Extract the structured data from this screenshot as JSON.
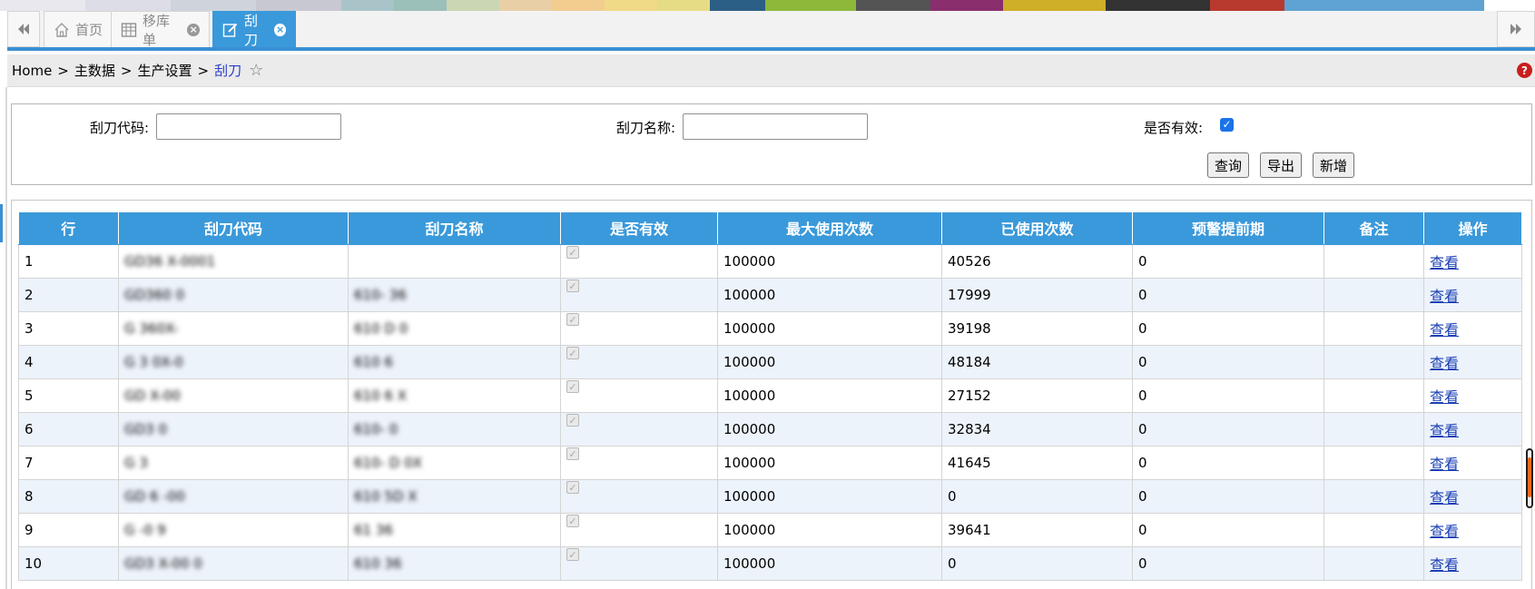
{
  "colors": {
    "accent": "#3a99da",
    "header_bg": "#3a99da",
    "row_alt": "#edf3fb",
    "link": "#1a3fb4",
    "help": "#c81e1e",
    "strip": [
      "#e8e8ee",
      "#dcdde6",
      "#cfd3dc",
      "#c7c8d2",
      "#a8c4c9",
      "#9bbfb9",
      "#cbd6b4",
      "#e8cfa6",
      "#f3cc90",
      "#f0d987",
      "#e6dc86",
      "#2c5f86",
      "#8db83a",
      "#545454",
      "#8a2e6e",
      "#cfae28",
      "#333333",
      "#b83a2e",
      "#5ea3d4"
    ]
  },
  "tabs": {
    "back_icon": "double-left-icon",
    "forward_icon": "double-right-icon",
    "items": [
      {
        "label": "首页",
        "icon": "home-icon",
        "active": false
      },
      {
        "label": "移库单",
        "icon": "grid-icon",
        "active": false
      },
      {
        "label": "刮刀",
        "icon": "edit-icon",
        "active": true
      }
    ]
  },
  "breadcrumb": {
    "items": [
      "Home",
      "主数据",
      "生产设置"
    ],
    "current": "刮刀",
    "separator": ">",
    "star_icon": "star-icon",
    "help_icon": "help-icon"
  },
  "search": {
    "code_label": "刮刀代码:",
    "code_value": "",
    "name_label": "刮刀名称:",
    "name_value": "",
    "valid_label": "是否有效:",
    "valid_checked": true,
    "query_button": "查询",
    "export_button": "导出",
    "add_button": "新增"
  },
  "table": {
    "columns": [
      "行",
      "刮刀代码",
      "刮刀名称",
      "是否有效",
      "最大使用次数",
      "已使用次数",
      "预警提前期",
      "备注",
      "操作"
    ],
    "rows": [
      {
        "row": "1",
        "code": "GD36  X-0001",
        "name": "",
        "valid": true,
        "max": "100000",
        "used": "40526",
        "warn": "0",
        "note": "",
        "action": "查看"
      },
      {
        "row": "2",
        "code": "GD360    0",
        "name": "610-  36",
        "valid": true,
        "max": "100000",
        "used": "17999",
        "warn": "0",
        "note": "",
        "action": "查看"
      },
      {
        "row": "3",
        "code": "G 360X-",
        "name": "610  D  0",
        "valid": true,
        "max": "100000",
        "used": "39198",
        "warn": "0",
        "note": "",
        "action": "查看"
      },
      {
        "row": "4",
        "code": "G  3  0X-0",
        "name": "610  6",
        "valid": true,
        "max": "100000",
        "used": "48184",
        "warn": "0",
        "note": "",
        "action": "查看"
      },
      {
        "row": "5",
        "code": "GD   X-00",
        "name": "610  6   X",
        "valid": true,
        "max": "100000",
        "used": "27152",
        "warn": "0",
        "note": "",
        "action": "查看"
      },
      {
        "row": "6",
        "code": "GD3    0",
        "name": "610-   0",
        "valid": true,
        "max": "100000",
        "used": "32834",
        "warn": "0",
        "note": "",
        "action": "查看"
      },
      {
        "row": "7",
        "code": "G  3",
        "name": "610-  D  0X",
        "valid": true,
        "max": "100000",
        "used": "41645",
        "warn": "0",
        "note": "",
        "action": "查看"
      },
      {
        "row": "8",
        "code": "GD   6  -00",
        "name": "610  5D  X",
        "valid": true,
        "max": "100000",
        "used": "0",
        "warn": "0",
        "note": "",
        "action": "查看"
      },
      {
        "row": "9",
        "code": "G     -0  9",
        "name": "61  36",
        "valid": true,
        "max": "100000",
        "used": "39641",
        "warn": "0",
        "note": "",
        "action": "查看"
      },
      {
        "row": "10",
        "code": "GD3   X-00  0",
        "name": "610  36",
        "valid": true,
        "max": "100000",
        "used": "0",
        "warn": "0",
        "note": "",
        "action": "查看"
      }
    ]
  }
}
